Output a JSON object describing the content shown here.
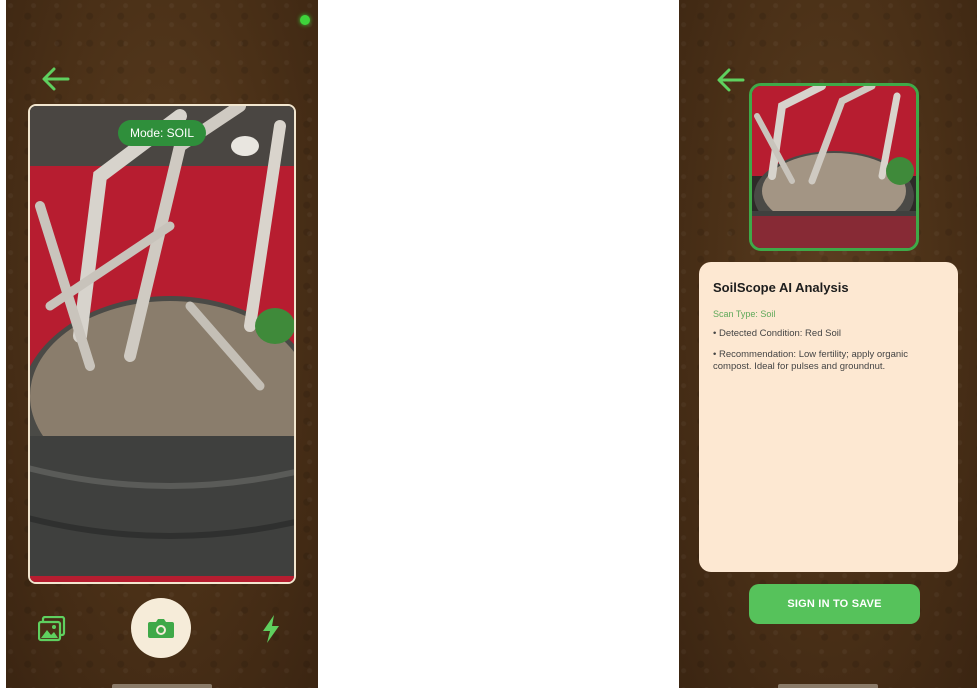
{
  "camera": {
    "mode_label": "Mode: SOIL"
  },
  "analysis": {
    "title": "SoilScope AI Analysis",
    "scan_type": "Scan Type: Soil",
    "condition": "• Detected Condition: Red Soil",
    "recommendation": "• Recommendation: Low fertility; apply organic compost. Ideal for pulses and groundnut.",
    "sign_in_label": "SIGN IN TO SAVE"
  },
  "icons": {
    "back": "arrow-left-icon",
    "gallery": "gallery-icon",
    "shutter": "camera-icon",
    "flash": "flash-icon",
    "status": "status-dot-icon"
  },
  "colors": {
    "accent_green": "#56c25b",
    "badge_green": "#2f8f3b",
    "soil_brown": "#4a3017",
    "card_cream": "#fde8d2"
  }
}
